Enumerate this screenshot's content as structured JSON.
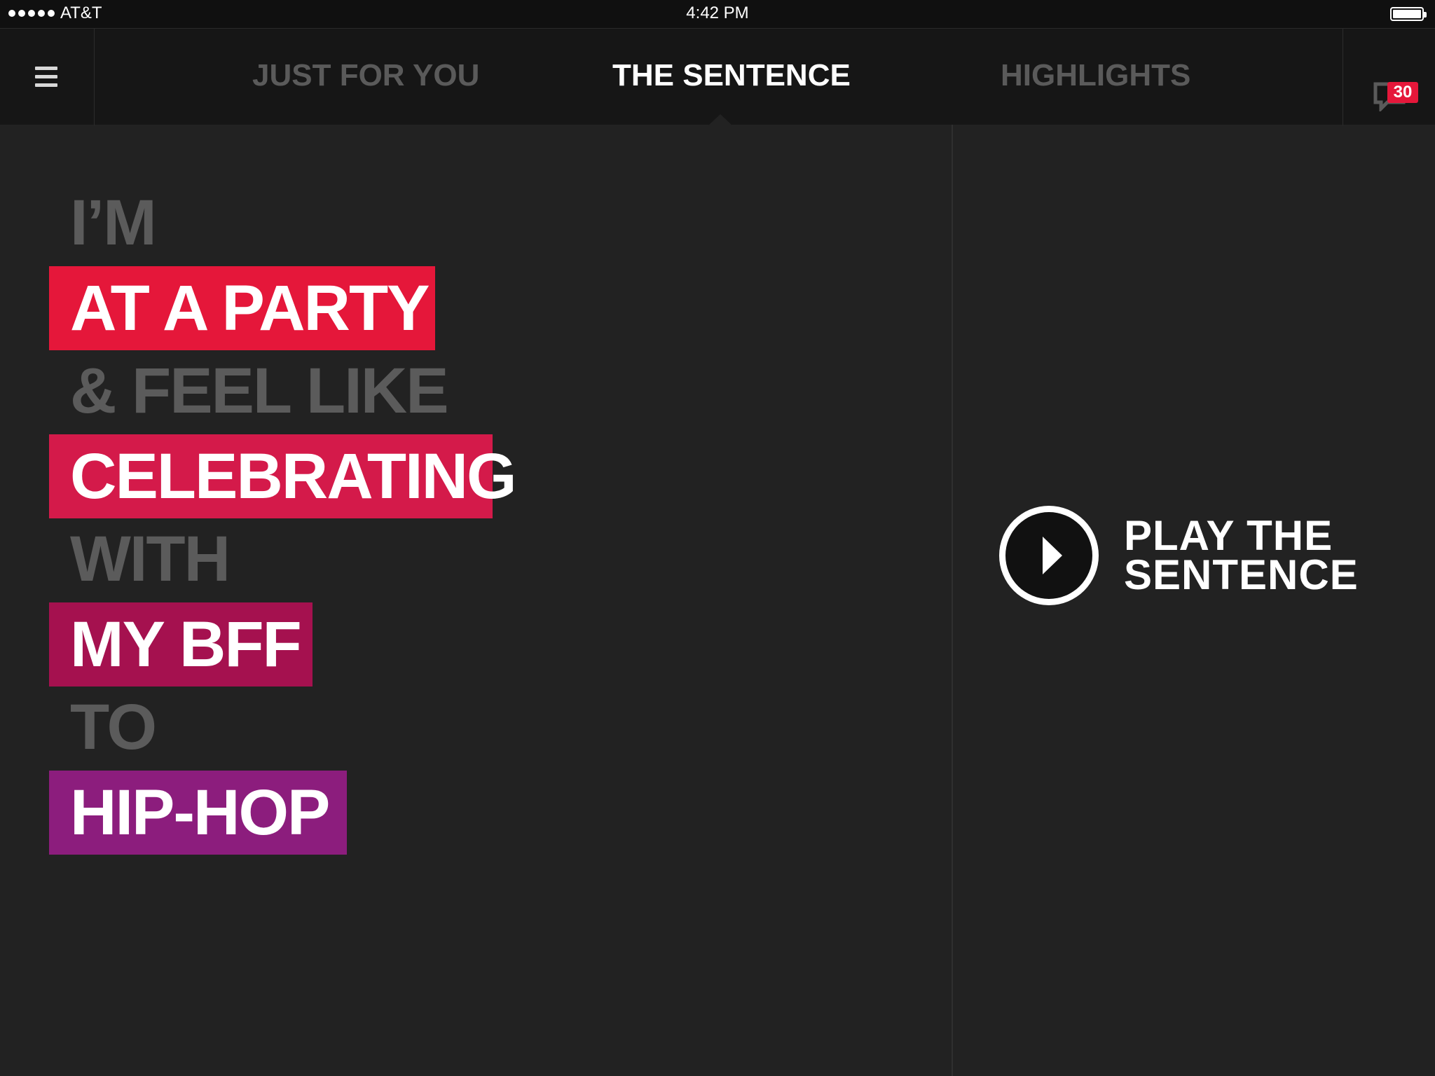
{
  "status_bar": {
    "carrier": "AT&T",
    "time": "4:42 PM"
  },
  "nav": {
    "tabs": [
      {
        "label": "JUST FOR YOU",
        "active": false
      },
      {
        "label": "THE SENTENCE",
        "active": true
      },
      {
        "label": "HIGHLIGHTS",
        "active": false
      }
    ],
    "notification_count": "30"
  },
  "sentence": {
    "lines": [
      {
        "text": "I’M",
        "highlight": false
      },
      {
        "text": "AT A PARTY",
        "highlight": true,
        "color": "#e5173a"
      },
      {
        "text": "& FEEL LIKE",
        "highlight": false
      },
      {
        "text": "CELEBRATING",
        "highlight": true,
        "color": "#d41a4a"
      },
      {
        "text": "WITH",
        "highlight": false
      },
      {
        "text": "MY BFF",
        "highlight": true,
        "color": "#a5114f"
      },
      {
        "text": "TO",
        "highlight": false
      },
      {
        "text": "HIP-HOP",
        "highlight": true,
        "color": "#8c1d7d"
      }
    ]
  },
  "play": {
    "line1": "PLAY THE",
    "line2": "SENTENCE"
  },
  "colors": {
    "background": "#222222",
    "nav_background": "#161616",
    "inactive_text": "#5b5b5b",
    "badge": "#e5173a"
  }
}
